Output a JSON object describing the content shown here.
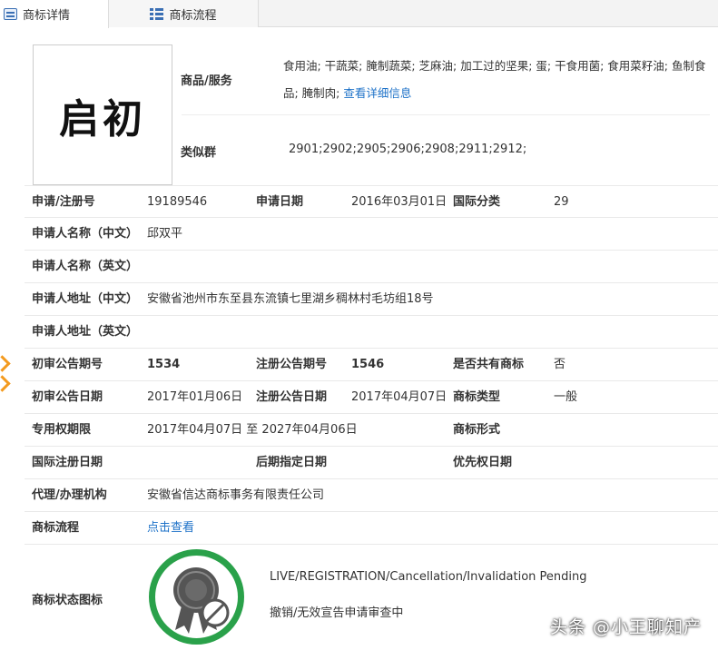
{
  "tabs": {
    "detail": "商标详情",
    "flow": "商标流程"
  },
  "logo": {
    "text": "启初"
  },
  "goods": {
    "label": "商品/服务",
    "text": "食用油; 干蔬菜; 腌制蔬菜; 芝麻油; 加工过的坚果; 蛋; 干食用菌; 食用菜籽油; 鱼制食品; 腌制肉;",
    "link": "查看详细信息"
  },
  "similar": {
    "label": "类似群",
    "value": "2901;2902;2905;2906;2908;2911;2912;"
  },
  "rows": {
    "reg_no_label": "申请/注册号",
    "reg_no": "19189546",
    "apply_date_label": "申请日期",
    "apply_date": "2016年03月01日",
    "intl_class_label": "国际分类",
    "intl_class": "29",
    "applicant_cn_label": "申请人名称（中文）",
    "applicant_cn": "邱双平",
    "applicant_en_label": "申请人名称（英文）",
    "address_cn_label": "申请人地址（中文）",
    "address_cn": "安徽省池州市东至县东流镇七里湖乡稠林村毛坊组18号",
    "address_en_label": "申请人地址（英文）",
    "prelim_no_label": "初审公告期号",
    "prelim_no": "1534",
    "reg_pub_no_label": "注册公告期号",
    "reg_pub_no": "1546",
    "shared_label": "是否共有商标",
    "shared": "否",
    "prelim_date_label": "初审公告日期",
    "prelim_date": "2017年01月06日",
    "reg_pub_date_label": "注册公告日期",
    "reg_pub_date": "2017年04月07日",
    "mark_type_label": "商标类型",
    "mark_type": "一般",
    "term_label": "专用权期限",
    "term": "2017年04月07日 至 2027年04月06日",
    "mark_form_label": "商标形式",
    "intl_reg_date_label": "国际注册日期",
    "later_date_label": "后期指定日期",
    "priority_date_label": "优先权日期",
    "agency_label": "代理/办理机构",
    "agency": "安徽省信达商标事务有限责任公司",
    "flow_label": "商标流程",
    "flow_link": "点击查看"
  },
  "status": {
    "label": "商标状态图标",
    "en": "LIVE/REGISTRATION/Cancellation/Invalidation Pending",
    "cn": "撤销/无效宣告申请审查中"
  },
  "watermark": "头条 @小王聊知产",
  "colors": {
    "link": "#1e72c8",
    "badge_ring": "#2aa14a",
    "edge_arrow": "#f39a1e"
  }
}
